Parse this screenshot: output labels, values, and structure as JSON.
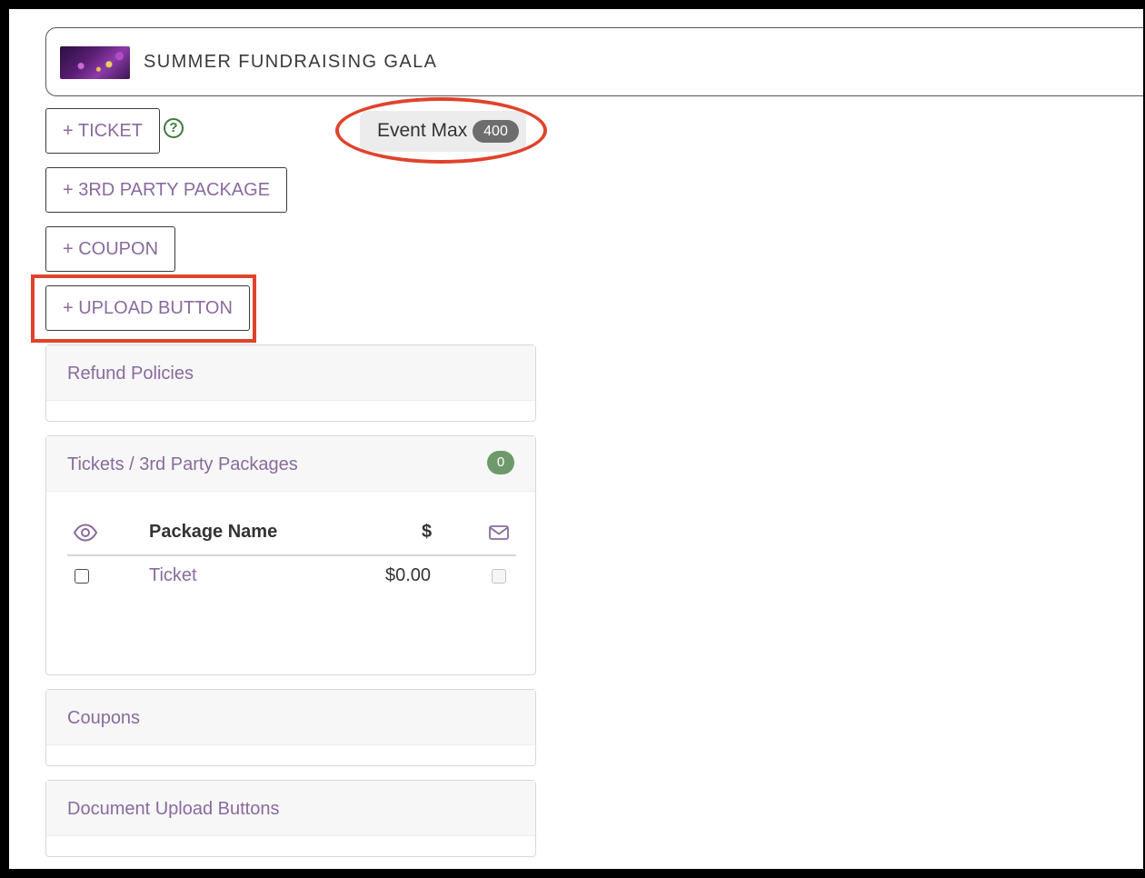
{
  "event": {
    "title": "SUMMER FUNDRAISING GALA",
    "thumbnail_icon": "event-image"
  },
  "actions": {
    "ticket": "+ TICKET",
    "third_party_package": "+ 3RD PARTY PACKAGE",
    "coupon": "+ COUPON",
    "upload_button": "+ UPLOAD BUTTON"
  },
  "help_icon": "?",
  "event_max": {
    "label": "Event Max",
    "value": "400"
  },
  "panels": {
    "refund_policies": {
      "title": "Refund Policies"
    },
    "tickets": {
      "title": "Tickets / 3rd Party Packages",
      "count": "0",
      "columns": {
        "visible_icon": "eye-icon",
        "name": "Package Name",
        "price": "$",
        "email_icon": "envelope-icon"
      },
      "rows": [
        {
          "name": "Ticket",
          "price": "$0.00",
          "visible": false,
          "email": false
        }
      ]
    },
    "coupons": {
      "title": "Coupons"
    },
    "document_upload": {
      "title": "Document Upload Buttons"
    }
  },
  "colors": {
    "accent": "#8a6a9e",
    "annotation": "#e0432c",
    "badge_green": "#6e9a6b",
    "badge_gray": "#6d6d6d"
  }
}
